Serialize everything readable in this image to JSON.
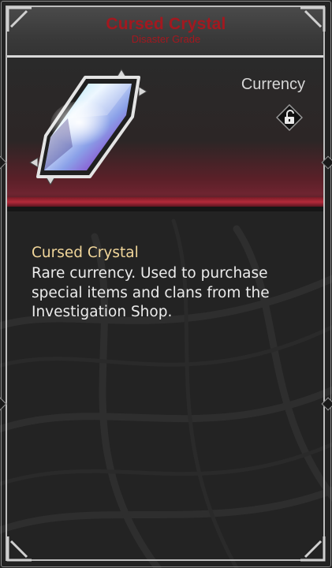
{
  "item": {
    "name": "Cursed Crystal",
    "grade": "Disaster Grade",
    "type": "Currency",
    "description_title": "Cursed Crystal",
    "description": "Rare currency. Used to purchase special items and clans from the Investigation Shop."
  },
  "icons": {
    "item_image": "crystal-icon",
    "lock": "unlock-icon"
  },
  "colors": {
    "grade_red": "#a3181f",
    "accent_band": "#b42a3a",
    "description_title": "#f1d69a",
    "card_bg": "#232323"
  }
}
